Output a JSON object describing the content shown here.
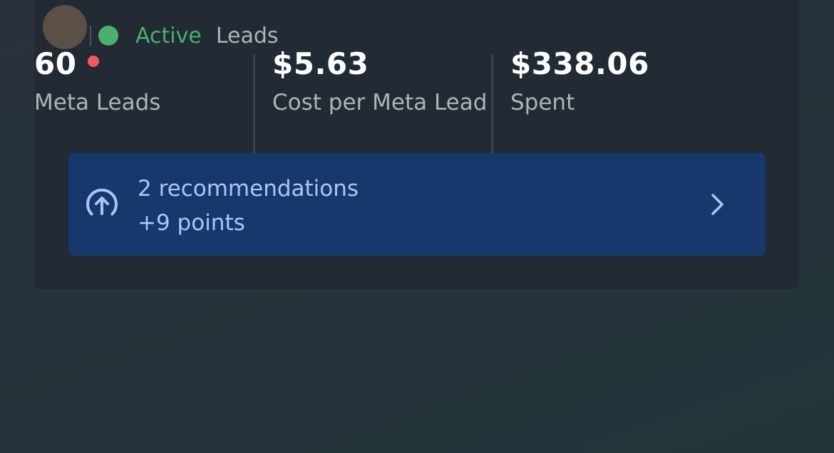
{
  "campaign": {
    "status": "Active",
    "objective": "Leads"
  },
  "metrics": [
    {
      "value": "60",
      "label": "Meta Leads",
      "has_alert": true
    },
    {
      "value": "$5.63",
      "label": "Cost per Meta Lead",
      "has_alert": false
    },
    {
      "value": "$338.06",
      "label": "Spent",
      "has_alert": false
    }
  ],
  "recommendations": {
    "title": "2 recommendations",
    "points": "+9 points",
    "icon": "arrow-up-circle-icon"
  },
  "colors": {
    "status_active": "#4caf6e",
    "alert_dot": "#f05a5e",
    "recommendation_bg": "#16386d",
    "recommendation_text": "#a9c7f5"
  }
}
